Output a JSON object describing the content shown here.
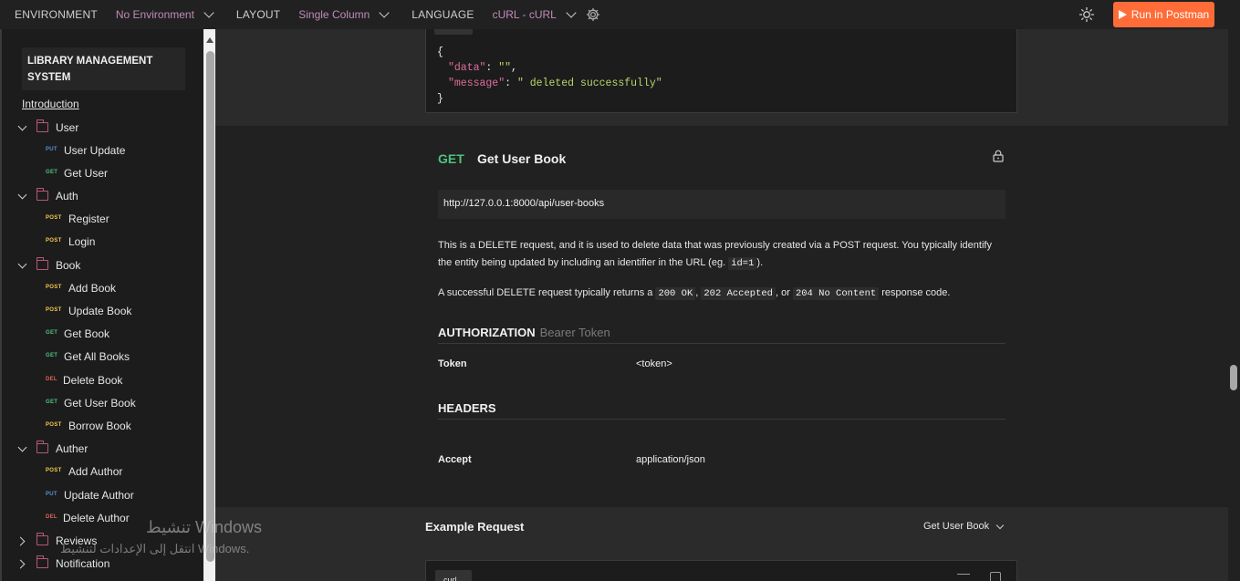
{
  "topbar": {
    "environment_label": "ENVIRONMENT",
    "environment_value": "No Environment",
    "layout_label": "LAYOUT",
    "layout_value": "Single Column",
    "language_label": "LANGUAGE",
    "language_value": "cURL - cURL",
    "run_button": "Run in Postman",
    "accent_color": "#ff6c37"
  },
  "sidebar": {
    "collection_title": "LIBRARY MANAGEMENT SYSTEM",
    "introduction": "Introduction",
    "folders": [
      {
        "name": "User",
        "expanded": true,
        "requests": [
          {
            "method": "PUT",
            "label": "User Update"
          },
          {
            "method": "GET",
            "label": "Get User"
          }
        ]
      },
      {
        "name": "Auth",
        "expanded": true,
        "requests": [
          {
            "method": "POST",
            "label": "Register"
          },
          {
            "method": "POST",
            "label": "Login"
          }
        ]
      },
      {
        "name": "Book",
        "expanded": true,
        "requests": [
          {
            "method": "POST",
            "label": "Add Book"
          },
          {
            "method": "POST",
            "label": "Update Book"
          },
          {
            "method": "GET",
            "label": "Get Book"
          },
          {
            "method": "GET",
            "label": "Get All Books"
          },
          {
            "method": "DEL",
            "label": "Delete Book"
          },
          {
            "method": "GET",
            "label": "Get User Book"
          },
          {
            "method": "POST",
            "label": "Borrow Book"
          }
        ]
      },
      {
        "name": "Auther",
        "expanded": true,
        "requests": [
          {
            "method": "POST",
            "label": "Add Author"
          },
          {
            "method": "PUT",
            "label": "Update Author"
          },
          {
            "method": "DEL",
            "label": "Delete Author"
          }
        ]
      },
      {
        "name": "Reviews",
        "expanded": false,
        "requests": []
      },
      {
        "name": "Notification",
        "expanded": false,
        "requests": []
      }
    ]
  },
  "response_example": {
    "open_brace": "{",
    "data_key": "\"data\"",
    "data_value": "\"\"",
    "message_key": "\"message\"",
    "message_value": "\" deleted successfully\"",
    "close_brace": "}"
  },
  "request": {
    "method": "GET",
    "name": "Get User Book",
    "url": "http://127.0.0.1:8000/api/user-books",
    "desc_1a": "This is a DELETE request, and it is used to delete data that was previously created via a POST request. You typically identify the entity being updated by including an identifier in the URL (eg. ",
    "desc_1_code": "id=1",
    "desc_1b": ").",
    "desc_2a": "A successful DELETE request typically returns a ",
    "desc_2_code1": "200 OK",
    "desc_2_sep1": ", ",
    "desc_2_code2": "202 Accepted",
    "desc_2_sep2": ", or ",
    "desc_2_code3": "204 No Content",
    "desc_2b": " response code.",
    "authorization_label": "AUTHORIZATION",
    "authorization_type": "Bearer Token",
    "token_key": "Token",
    "token_value": "<token>",
    "headers_label": "HEADERS",
    "header_key": "Accept",
    "header_value": "application/json"
  },
  "example": {
    "title": "Example Request",
    "selected": "Get User Book",
    "tab": "curl"
  },
  "watermark": {
    "line1": "تنشيط Windows",
    "line2": "انتقل إلى الإعدادات لتنشيط Windows."
  }
}
